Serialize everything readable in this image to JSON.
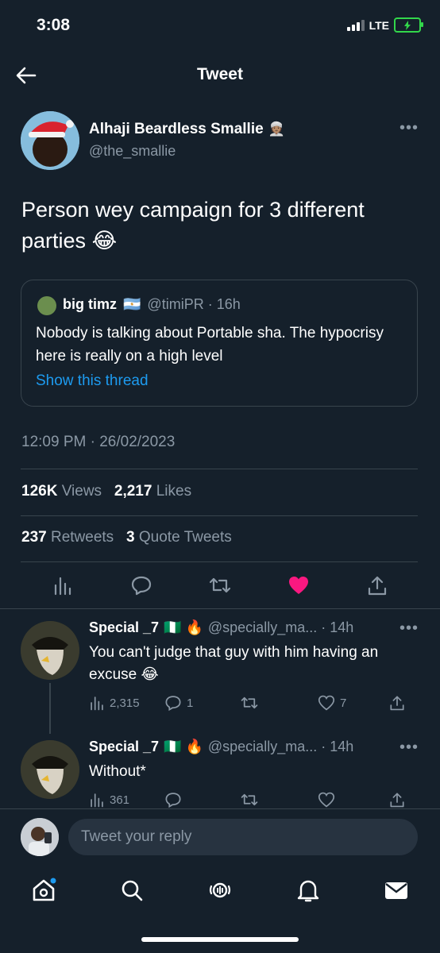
{
  "status_bar": {
    "time": "3:08",
    "network": "LTE"
  },
  "header": {
    "title": "Tweet"
  },
  "tweet": {
    "author_name": "Alhaji Beardless Smallie",
    "author_handle": "@the_smallie",
    "text": "Person wey campaign for 3 different parties",
    "text_emoji": "😂",
    "timestamp": "12:09 PM · 26/02/2023",
    "views_count": "126K",
    "views_label": "Views",
    "likes_count": "2,217",
    "likes_label": "Likes",
    "retweets_count": "237",
    "retweets_label": "Retweets",
    "quotes_count": "3",
    "quotes_label": "Quote Tweets",
    "liked": true
  },
  "quote": {
    "author_name": "big timz",
    "flag": "🇦🇷",
    "handle_time": "@timiPR · 16h",
    "text": "Nobody is talking about Portable sha. The hypocrisy here is really on a high level",
    "show_thread": "Show this thread"
  },
  "replies": [
    {
      "name": "Special _7",
      "badges": "🇳🇬 🔥",
      "handle_time": "@specially_ma... · 14h",
      "text": "You can't judge that guy with him having an excuse",
      "text_emoji": "😂",
      "views": "2,315",
      "replies": "1",
      "retweets": "",
      "likes": "7"
    },
    {
      "name": "Special _7",
      "badges": "🇳🇬 🔥",
      "handle_time": "@specially_ma... · 14h",
      "text": "Without*",
      "text_emoji": "",
      "views": "361",
      "replies": "",
      "retweets": "",
      "likes": ""
    }
  ],
  "reply_bar": {
    "placeholder": "Tweet your reply"
  },
  "colors": {
    "background": "#15202b",
    "accent": "#1d9bf0",
    "like": "#f91880",
    "muted": "#8b98a5",
    "border": "#38444d"
  },
  "icons": [
    "back-arrow-icon",
    "more-icon",
    "views-icon",
    "reply-icon",
    "retweet-icon",
    "heart-icon",
    "share-icon",
    "home-icon",
    "search-icon",
    "spaces-icon",
    "notifications-icon",
    "messages-icon"
  ]
}
